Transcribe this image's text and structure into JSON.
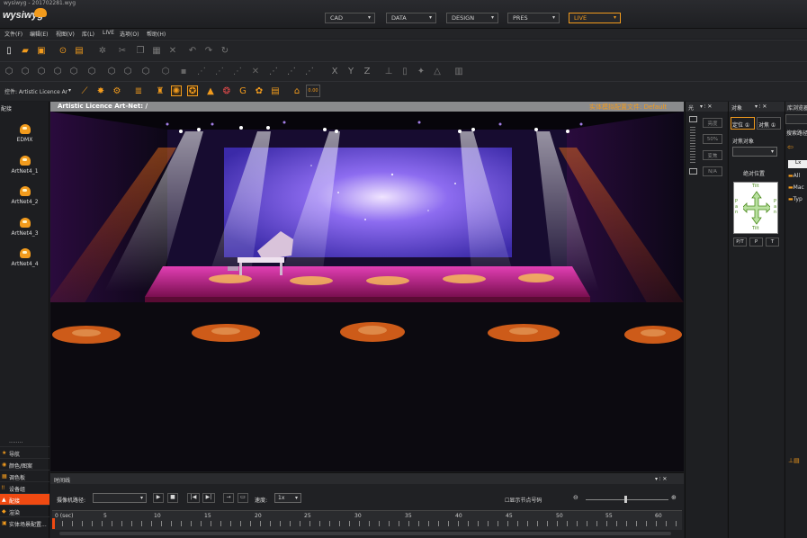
{
  "app": {
    "window_title": "wysiwyg - 201702281.wyg",
    "logo_text": "wysiwyg"
  },
  "modes": [
    {
      "label": "CAD",
      "active": false
    },
    {
      "label": "DATA",
      "active": false
    },
    {
      "label": "DESIGN",
      "active": false
    },
    {
      "label": "PRES",
      "active": false
    },
    {
      "label": "LIVE",
      "active": true
    }
  ],
  "menu": [
    "文件(F)",
    "编辑(E)",
    "视图(V)",
    "库(L)",
    "LIVE",
    "选项(O)",
    "帮助(H)"
  ],
  "control_bar": {
    "label": "控件: Artistic Licence Ar",
    "counter": "0.00"
  },
  "left_panel": {
    "title": "配接",
    "libraries": [
      "EDMX",
      "ArtNet4_1",
      "ArtNet4_2",
      "ArtNet4_3",
      "ArtNet4_4"
    ],
    "dots": "........",
    "nav_items": [
      {
        "label": "导航",
        "active": false
      },
      {
        "label": "颜色/图案",
        "active": false
      },
      {
        "label": "调色板",
        "active": false
      },
      {
        "label": "设备组",
        "active": false
      },
      {
        "label": "配接",
        "active": true
      },
      {
        "label": "渲染",
        "active": false
      },
      {
        "label": "实体场景配置...",
        "active": false
      }
    ]
  },
  "viewport": {
    "title": "Artistic Licence Art-Net: /",
    "status": "实体模拟配置文件: Default"
  },
  "light_panel": {
    "title": "光",
    "buttons": [
      "亮度",
      "50%",
      "变焦",
      "N/A"
    ]
  },
  "object_panel": {
    "title": "对象",
    "tabs": [
      "定位 ①",
      "对焦 ①"
    ],
    "focus_label": "对焦对象",
    "abs_position": "绝对位置",
    "tilt": "Tilt",
    "pan": "Pan",
    "bottom_buttons": [
      "P/T",
      "P",
      "T"
    ]
  },
  "library_panel": {
    "title": "库浏览器",
    "search_label": "搜索路径",
    "tree": [
      "All",
      "Mac",
      "Typ"
    ],
    "path_value": "Lx"
  },
  "timeline": {
    "title": "时间线",
    "camera_label": "摄像机路径:",
    "speed_label": "速度:",
    "speed_value": "1x",
    "show_nodes": "显示节点号码",
    "ruler": [
      "0 (sec)",
      "5",
      "10",
      "15",
      "20",
      "25",
      "30",
      "35",
      "40",
      "45",
      "50",
      "55",
      "60"
    ]
  },
  "panel_controls": "▾ ⫶ ✕",
  "colors": {
    "accent": "#f29b1d",
    "active_nav": "#f04a12",
    "background": "#1b1c1f"
  }
}
